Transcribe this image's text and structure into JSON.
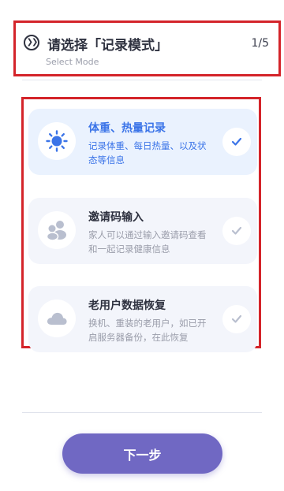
{
  "header": {
    "title": "请选择「记录模式」",
    "subtitle": "Select Mode",
    "step": "1/5",
    "icon": "double-chevron-right-icon"
  },
  "options": [
    {
      "title": "体重、热量记录",
      "desc": "记录体重、每日热量、以及状态等信息",
      "icon": "sun-icon",
      "selected": true
    },
    {
      "title": "邀请码输入",
      "desc": "家人可以通过输入邀请码查看和一起记录健康信息",
      "icon": "family-icon",
      "selected": false
    },
    {
      "title": "老用户数据恢复",
      "desc": "换机、重装的老用户，如已开启服务器备份，在此恢复",
      "icon": "cloud-icon",
      "selected": false
    }
  ],
  "next_button": {
    "label": "下一步"
  },
  "colors": {
    "accent_blue": "#3b74e8",
    "button_purple": "#7068c3",
    "highlight_border": "#d4242a"
  }
}
